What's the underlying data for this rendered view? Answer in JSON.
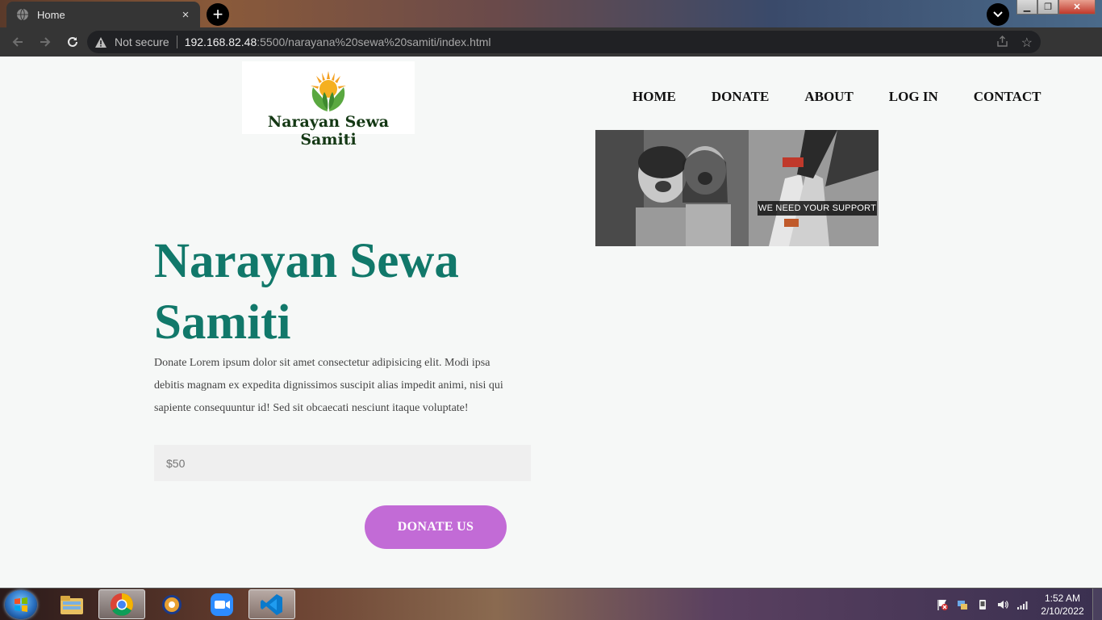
{
  "browser": {
    "tab_title": "Home",
    "tab_close": "×",
    "new_tab": "+",
    "security_label": "Not secure",
    "url_host": "192.168.82.48",
    "url_path": ":5500/narayana%20sewa%20samiti/index.html"
  },
  "header": {
    "logo_text": "Narayan Sewa Samiti",
    "nav": [
      "HOME",
      "DONATE",
      "ABOUT",
      "LOG IN",
      "CONTACT"
    ]
  },
  "banner": {
    "caption": "WE NEED YOUR SUPPORT"
  },
  "hero": {
    "title_line1": "Narayan Sewa",
    "title_line2": "Samiti",
    "description": "Donate Lorem ipsum dolor sit amet consectetur adipisicing elit. Modi ipsa debitis magnam ex expedita dignissimos suscipit alias impedit animi, nisi qui sapiente consequuntur id! Sed sit obcaecati nesciunt itaque voluptate!",
    "amount_placeholder": "$50",
    "donate_button": "DONATE US"
  },
  "taskbar": {
    "time": "1:52 AM",
    "date": "2/10/2022"
  },
  "colors": {
    "title_color": "#11786a",
    "button_color": "#c26bd6",
    "page_background": "#f6f8f7"
  }
}
